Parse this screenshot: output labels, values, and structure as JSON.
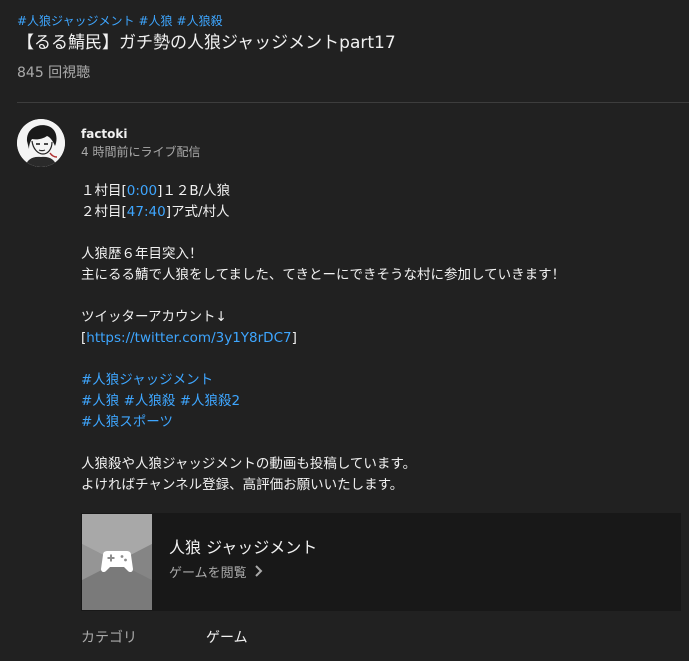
{
  "video": {
    "hashtags": [
      "#人狼ジャッジメント",
      "#人狼",
      "#人狼殺"
    ],
    "title": "【るる鯖民】ガチ勢の人狼ジャッジメントpart17",
    "views": "845 回視聴"
  },
  "channel": {
    "name": "factoki",
    "meta": "4 時間前にライブ配信"
  },
  "description": {
    "line1_prefix": "１村目[",
    "line1_time": "0:00",
    "line1_suffix": "]１２B/人狼",
    "line2_prefix": "２村目[",
    "line2_time": "47:40",
    "line2_suffix": "]ア式/村人",
    "intro1": "人狼歴６年目突入！",
    "intro2": "主にるる鯖で人狼をしてました、てきとーにできそうな村に参加していきます！",
    "twitter_heading": "ツイッターアカウント↓",
    "twitter_open": "[",
    "twitter_url": "https://twitter.com/3y1Y8rDC7",
    "twitter_close": "]",
    "tags_row1": [
      "#人狼ジャッジメント"
    ],
    "tags_row2": [
      "#人狼",
      "#人狼殺",
      "#人狼殺2"
    ],
    "tags_row3": [
      "#人狼スポーツ"
    ],
    "outro1": "人狼殺や人狼ジャッジメントの動画も投稿しています。",
    "outro2": "よければチャンネル登録、高評価お願いいたします。"
  },
  "game_card": {
    "title": "人狼 ジャッジメント",
    "browse_label": "ゲームを閲覧",
    "icon": "gamepad-icon"
  },
  "category": {
    "label": "カテゴリ",
    "value": "ゲーム"
  },
  "colors": {
    "background": "#212121",
    "link": "#3ea6ff",
    "text": "#f1f1f1",
    "muted": "#aaaaaa",
    "card_bg": "#181818"
  }
}
